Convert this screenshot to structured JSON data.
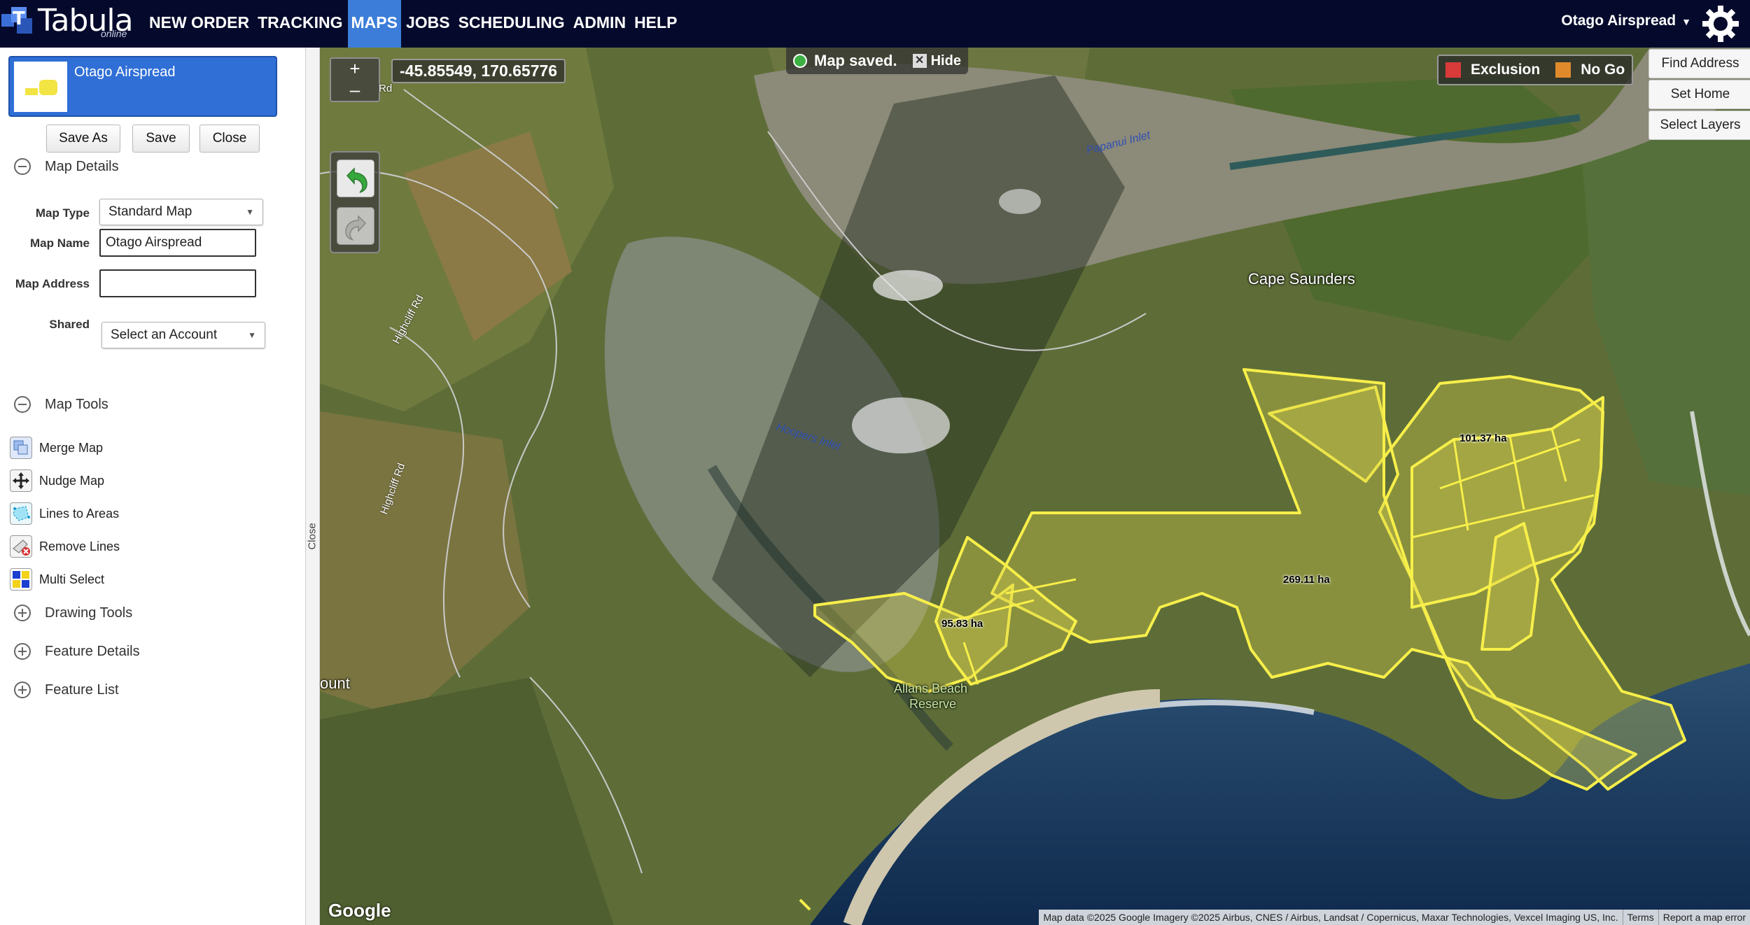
{
  "app": {
    "logo_text": "Tabula",
    "logo_sub": "online",
    "nav": [
      {
        "label": "NEW ORDER"
      },
      {
        "label": "TRACKING"
      },
      {
        "label": "MAPS"
      },
      {
        "label": "JOBS"
      },
      {
        "label": "SCHEDULING"
      },
      {
        "label": "ADMIN"
      },
      {
        "label": "HELP"
      }
    ],
    "active_nav": "MAPS",
    "account": "Otago Airspread"
  },
  "sidebar": {
    "map_card_title": "Otago Airspread",
    "buttons": {
      "save_as": "Save As",
      "save": "Save",
      "close": "Close"
    },
    "map_details": {
      "heading": "Map Details",
      "map_type_label": "Map Type",
      "map_type_value": "Standard Map",
      "map_name_label": "Map Name",
      "map_name_value": "Otago Airspread",
      "map_address_label": "Map Address",
      "map_address_value": "",
      "shared_label": "Shared",
      "shared_value": "Select an Account"
    },
    "map_tools": {
      "heading": "Map Tools",
      "items": [
        {
          "label": "Merge Map"
        },
        {
          "label": "Nudge Map"
        },
        {
          "label": "Lines to Areas"
        },
        {
          "label": "Remove Lines"
        },
        {
          "label": "Multi Select"
        }
      ]
    },
    "drawing_tools": "Drawing Tools",
    "feature_details": "Feature Details",
    "feature_list": "Feature List",
    "close_strip": "Close"
  },
  "map": {
    "zoom_in": "+",
    "zoom_out": "–",
    "coords": "-45.85549, 170.65776",
    "saved_message": "Map saved.",
    "hide_label": "Hide",
    "legend": [
      {
        "label": "Exclusion",
        "color": "#d93a3a"
      },
      {
        "label": "No Go",
        "color": "#e08a2c"
      }
    ],
    "right_buttons": {
      "find": "Find Address",
      "home": "Set Home",
      "layers": "Select Layers"
    },
    "places": {
      "cape": "Cape Saunders",
      "allans": "Allans Beach",
      "reserve": "Reserve",
      "mount": "ount"
    },
    "water_labels": {
      "hoopers": "Hoopers Inlet",
      "papanui": "Papanui Inlet"
    },
    "road_labels": {
      "highcliff1": "Highcliff Rd",
      "highcliff2": "Highcliff Rd",
      "top_rd": "Rd"
    },
    "areas": {
      "a1": "101.37 ha",
      "a2": "269.11 ha",
      "a3": "95.83 ha"
    },
    "google": "Google",
    "attribution": {
      "data": "Map data ©2025 Google Imagery ©2025 Airbus, CNES / Airbus, Landsat / Copernicus, Maxar Technologies, Vexcel Imaging US, Inc.",
      "terms": "Terms",
      "report": "Report a map error"
    },
    "colors": {
      "boundary": "#f7ef4a",
      "sea": "#173a63",
      "land": "#5b6b35"
    }
  }
}
